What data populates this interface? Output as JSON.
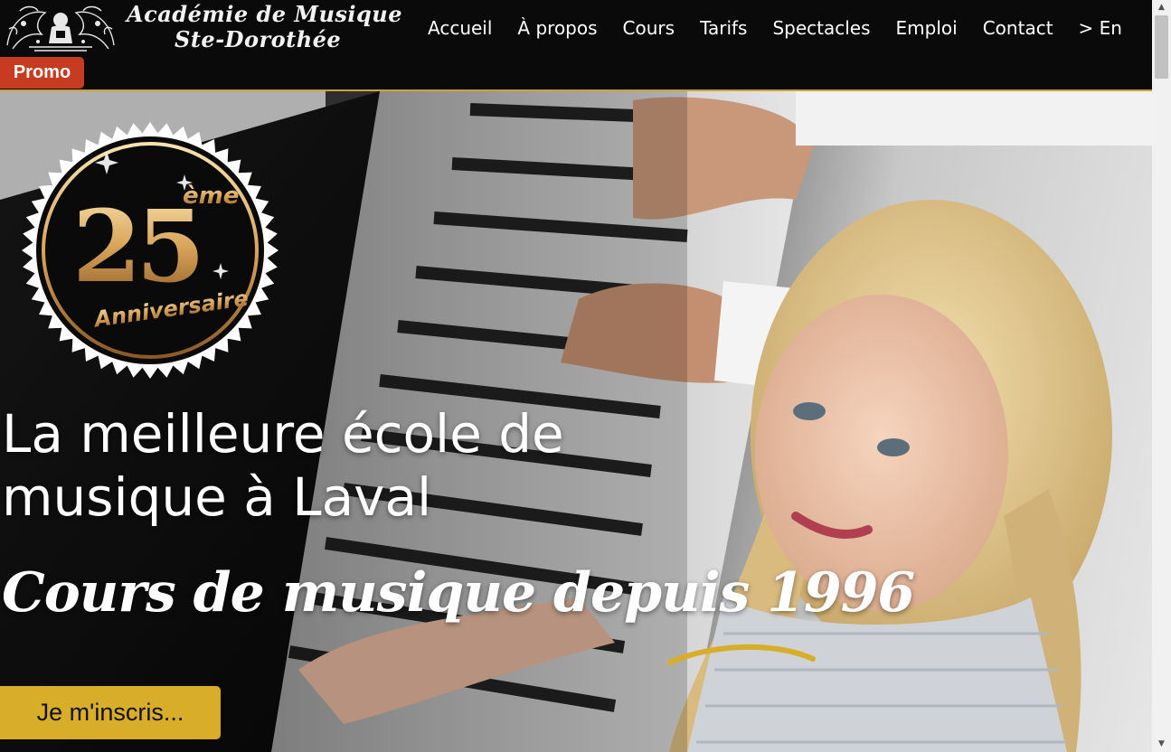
{
  "logo": {
    "line1": "Académie de Musique",
    "line2": "Ste-Dorothée",
    "icon": "crest-icon"
  },
  "nav": {
    "items": [
      "Accueil",
      "À propos",
      "Cours",
      "Tarifs",
      "Spectacles",
      "Emploi",
      "Contact",
      "> En"
    ]
  },
  "promo": {
    "label": "Promo"
  },
  "hero": {
    "badge": {
      "number": "25",
      "suffix": "ème",
      "label": "Anniversaire"
    },
    "title": "La meilleure école de musique à Laval",
    "subtitle": "Cours de musique depuis 1996",
    "cta": "Je m'inscris..."
  },
  "colors": {
    "header_bg": "#0a0a0a",
    "accent_gold": "#d8ad2a",
    "promo_red": "#c73b20"
  }
}
